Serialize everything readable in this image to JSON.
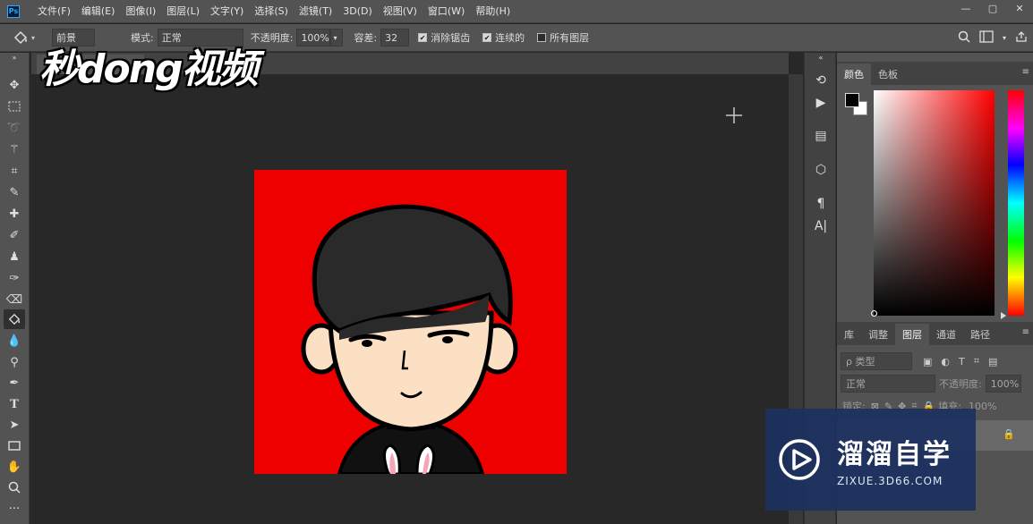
{
  "app": {
    "logo_text": "Ps"
  },
  "menu": [
    "文件(F)",
    "编辑(E)",
    "图像(I)",
    "图层(L)",
    "文字(Y)",
    "选择(S)",
    "滤镜(T)",
    "3D(D)",
    "视图(V)",
    "窗口(W)",
    "帮助(H)"
  ],
  "window_controls": {
    "minimize": "—",
    "restore": "▢",
    "close": "✕"
  },
  "options": {
    "fill_source": "前景",
    "mode_label": "模式:",
    "mode_value": "正常",
    "opacity_label": "不透明度:",
    "opacity_value": "100%",
    "tolerance_label": "容差:",
    "tolerance_value": "32",
    "antialias_label": "消除锯齿",
    "antialias_checked": true,
    "contiguous_label": "连续的",
    "contiguous_checked": true,
    "all_layers_label": "所有图层",
    "all_layers_checked": false
  },
  "document": {
    "tab_title": ""
  },
  "watermark_logo": {
    "text": "秒dong视频"
  },
  "color_panel": {
    "tabs": [
      "颜色",
      "色板"
    ],
    "active_tab": "颜色",
    "foreground": "#000000",
    "background": "#ffffff"
  },
  "layers_panel": {
    "tabs": [
      "库",
      "调整",
      "图层",
      "通道",
      "路径"
    ],
    "active_tab": "图层",
    "filter_label": "ρ 类型",
    "blend_mode": "正常",
    "opacity_label": "不透明度:",
    "opacity_value": "100%",
    "lock_label": "锁定:",
    "fill_label": "填充:",
    "fill_value": "100%"
  },
  "site_watermark": {
    "title": "溜溜自学",
    "subtitle": "ZIXUE.3D66.COM"
  },
  "colors": {
    "canvas_red": "#ee0000",
    "ui_dark": "#282828",
    "ui_panel": "#535353",
    "accent": "#31a8ff"
  }
}
